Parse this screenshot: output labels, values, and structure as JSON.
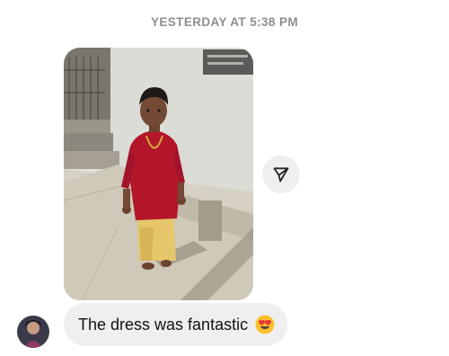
{
  "thread": {
    "timestamp": "YESTERDAY AT 5:38 PM",
    "messages": [
      {
        "type": "photo",
        "image_name": "boy-in-red-shirt-photo"
      },
      {
        "type": "text",
        "text": "The dress was fantastic",
        "emoji": "heart-eyes-emoji-icon"
      }
    ],
    "share_icon": "send-icon"
  },
  "colors": {
    "bubble_bg": "#efefef",
    "timestamp": "#8e8e8e",
    "text": "#111111"
  }
}
